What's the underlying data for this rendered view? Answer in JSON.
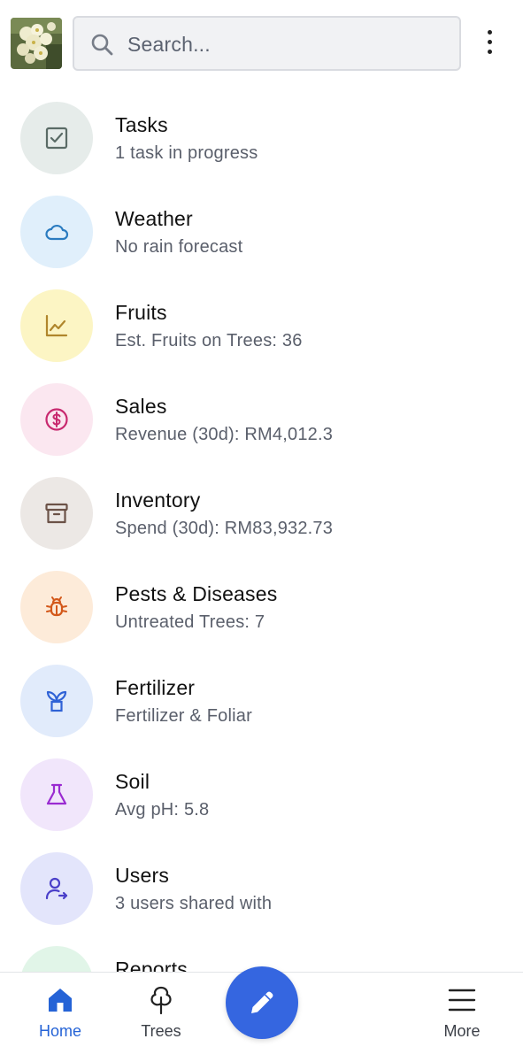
{
  "search": {
    "placeholder": "Search..."
  },
  "menu_items": [
    {
      "title": "Tasks",
      "subtitle": "1 task in progress",
      "icon": "checkbox-icon",
      "bg": "#e6ecea",
      "fg": "#5a6b66"
    },
    {
      "title": "Weather",
      "subtitle": "No rain forecast",
      "icon": "cloud-icon",
      "bg": "#e0effb",
      "fg": "#2a7bc0"
    },
    {
      "title": "Fruits",
      "subtitle": "Est. Fruits on Trees: 36",
      "icon": "chart-line-icon",
      "bg": "#fcf5c4",
      "fg": "#b0862c"
    },
    {
      "title": "Sales",
      "subtitle": "Revenue (30d): RM4,012.3",
      "icon": "dollar-circle-icon",
      "bg": "#fbe7f0",
      "fg": "#c8296f"
    },
    {
      "title": "Inventory",
      "subtitle": "Spend (30d): RM83,932.73",
      "icon": "archive-box-icon",
      "bg": "#ece8e5",
      "fg": "#6b5247"
    },
    {
      "title": "Pests & Diseases",
      "subtitle": "Untreated Trees: 7",
      "icon": "bug-icon",
      "bg": "#fdebd9",
      "fg": "#d3581a"
    },
    {
      "title": "Fertilizer",
      "subtitle": "Fertilizer & Foliar",
      "icon": "plant-pot-icon",
      "bg": "#e1ebfb",
      "fg": "#2f62d6"
    },
    {
      "title": "Soil",
      "subtitle": "Avg pH: 5.8",
      "icon": "flask-icon",
      "bg": "#f1e6fb",
      "fg": "#9a2bd1"
    },
    {
      "title": "Users",
      "subtitle": "3 users shared with",
      "icon": "user-share-icon",
      "bg": "#e3e5fb",
      "fg": "#4a3fc9"
    },
    {
      "title": "Reports",
      "subtitle": "",
      "icon": "report-icon",
      "bg": "#e1f5e8",
      "fg": "#1f8f4a"
    }
  ],
  "nav": {
    "home": {
      "label": "Home",
      "color": "#2563d6"
    },
    "trees": {
      "label": "Trees",
      "color": "#3b3f47"
    },
    "more": {
      "label": "More",
      "color": "#3b3f47"
    }
  },
  "fab": {
    "icon": "pencil-icon",
    "color": "#3566e0"
  }
}
